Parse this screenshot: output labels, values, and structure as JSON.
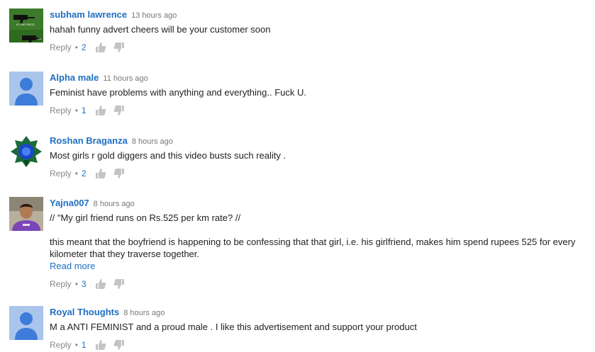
{
  "comments": [
    {
      "author": "subham lawrence",
      "time": "13 hours ago",
      "text": [
        "hahah funny advert cheers will be your customer soon"
      ],
      "reply_label": "Reply",
      "likes": "2",
      "avatar": "army-image",
      "avatar_text": [
        "IS THE SPICE",
        "OF"
      ]
    },
    {
      "author": "Alpha male",
      "time": "11 hours ago",
      "text": [
        "Feminist have problems with anything and everything.. Fuck U."
      ],
      "reply_label": "Reply",
      "likes": "1",
      "avatar": "default-user"
    },
    {
      "author": "Roshan Braganza",
      "time": "8 hours ago",
      "text": [
        "Most girls r gold diggers and this video busts such reality ."
      ],
      "reply_label": "Reply",
      "likes": "2",
      "avatar": "blue-emblem"
    },
    {
      "author": "Yajna007",
      "time": "8 hours ago",
      "text": [
        "// \"My girl friend runs on Rs.525 per km rate? //",
        "this meant that the boyfriend is happening to be confessing that that girl, i.e. his girlfriend, makes him spend rupees 525 for every kilometer that they traverse together."
      ],
      "read_more": "Read more",
      "reply_label": "Reply",
      "likes": "3",
      "avatar": "photo"
    },
    {
      "author": "Royal Thoughts",
      "time": "8 hours ago",
      "text": [
        "M a ANTI FEMINIST and a proud male . I like this advertisement and support your product"
      ],
      "reply_label": "Reply",
      "likes": "1",
      "avatar": "default-user"
    }
  ],
  "separator": "•",
  "icons": {
    "like": "thumbs-up-icon",
    "dislike": "thumbs-down-icon"
  },
  "colors": {
    "link": "#1e6fc3",
    "muted": "#888888",
    "default_avatar_bg": "#aac5ec",
    "default_avatar_fg": "#3d7cd9"
  }
}
